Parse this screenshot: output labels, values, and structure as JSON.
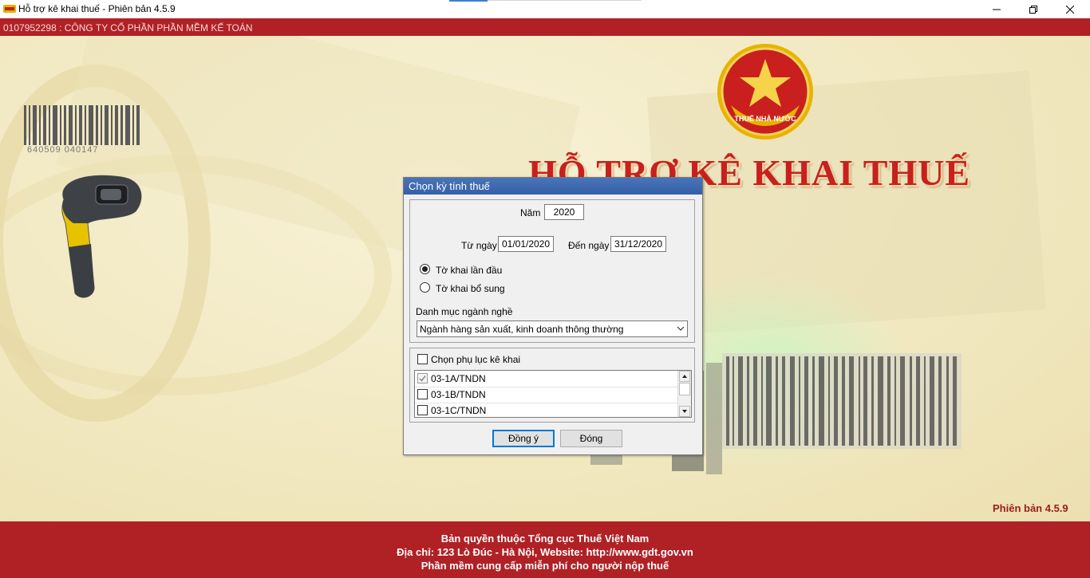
{
  "window": {
    "title": "Hỗ trợ kê khai thuế -  Phiên bản 4.5.9",
    "company": "0107952298 : CÔNG TY CỔ PHẦN PHẦN MỀM KẾ TOÁN"
  },
  "brand": {
    "emblem_text": "THUẾ NHÀ NƯỚC",
    "heading": "HỖ TRỢ KÊ KHAI THUẾ",
    "barcode_digits": "640509  040147",
    "version": "Phiên bản 4.5.9"
  },
  "footer": {
    "line1": "Bản quyền thuộc Tổng cục Thuế Việt Nam",
    "line2": "Địa chỉ: 123 Lò Đúc - Hà Nội, Website: http://www.gdt.gov.vn",
    "line3": "Phần mềm cung cấp miễn phí cho người nộp thuế"
  },
  "dialog": {
    "title": "Chọn kỳ tính thuế",
    "year_label": "Năm",
    "year_value": "2020",
    "from_label": "Từ ngày",
    "from_value": "01/01/2020",
    "to_label": "Đến ngày",
    "to_value": "31/12/2020",
    "radio_first": "Tờ khai lần đầu",
    "radio_supplement": "Tờ khai bổ sung",
    "selected_radio": "first",
    "category_label": "Danh mục ngành nghề",
    "category_value": "Ngành hàng sản xuất, kinh doanh thông thường",
    "appendix_label": "Chọn phụ lục kê khai",
    "appendix_checked": false,
    "appendices": [
      {
        "label": "03-1A/TNDN",
        "checked": true,
        "disabled": true
      },
      {
        "label": "03-1B/TNDN",
        "checked": false,
        "disabled": false
      },
      {
        "label": "03-1C/TNDN",
        "checked": false,
        "disabled": false
      }
    ],
    "ok_label": "Đồng ý",
    "close_label": "Đóng"
  },
  "colors": {
    "red_bar": "#b02126",
    "heading_red": "#c8201f",
    "dialog_title": "#3460a8",
    "background": "#f3ecc9"
  },
  "icons": [
    "app-icon",
    "minimize-icon",
    "maximize-icon",
    "close-icon",
    "tax-emblem-icon",
    "barcode-icon",
    "scanner-icon",
    "chevron-down-icon",
    "scroll-up-icon",
    "scroll-down-icon",
    "checkmark-icon"
  ]
}
